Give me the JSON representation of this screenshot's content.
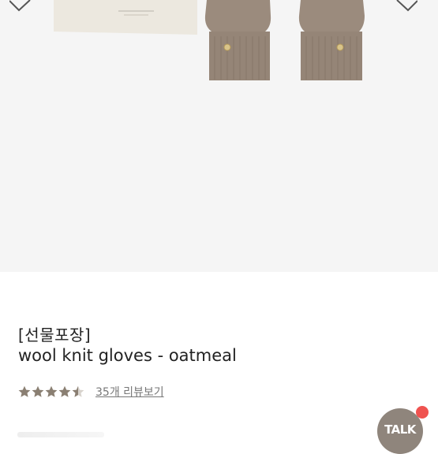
{
  "gallery": {
    "image_icon": "knit-gloves-product-photo",
    "prev_icon": "chevron-left-icon",
    "next_icon": "chevron-right-icon"
  },
  "product": {
    "subtitle": "[선물포장]",
    "title": "wool knit gloves - oatmeal",
    "rating": 4.5,
    "rating_max": 5,
    "review_link": "35개 리뷰보기"
  },
  "talk": {
    "label": "TALK",
    "icon": "chat-icon"
  },
  "colors": {
    "star": "#8a7f72",
    "star_empty": "#d8d3cd",
    "talk_bg": "#8f857c",
    "notify_dot": "#ef5350",
    "glove": "#9a8a7c",
    "gallery_bg": "#f5f5f5"
  }
}
